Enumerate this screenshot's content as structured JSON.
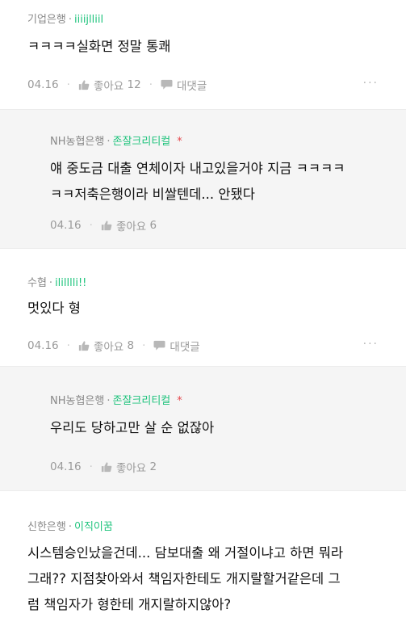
{
  "comments": [
    {
      "bank": "기업은행",
      "nickname": "iiiijlliil",
      "text_lines": [
        "ㅋㅋㅋㅋ실화면 정말 통쾌"
      ],
      "date": "04.16",
      "like_label": "좋아요",
      "like_count": "12",
      "reply_label": "대댓글",
      "more": "···"
    },
    {
      "bank": "NH농협은행",
      "nickname": "존잘크리티컬",
      "star": "*",
      "text_lines": [
        "얘 중도금 대출 연체이자 내고있을거야 지금 ㅋㅋㅋㅋ",
        "ㅋㅋ저축은행이라 비쌀텐데... 안됐다"
      ],
      "date": "04.16",
      "like_label": "좋아요",
      "like_count": "6"
    },
    {
      "bank": "수협",
      "nickname": "ililllli!!",
      "text_lines": [
        "멋있다 형"
      ],
      "date": "04.16",
      "like_label": "좋아요",
      "like_count": "8",
      "reply_label": "대댓글",
      "more": "···"
    },
    {
      "bank": "NH농협은행",
      "nickname": "존잘크리티컬",
      "star": "*",
      "text_lines": [
        "우리도 당하고만 살 순 없잖아"
      ],
      "date": "04.16",
      "like_label": "좋아요",
      "like_count": "2"
    },
    {
      "bank": "신한은행",
      "nickname": "이직이꿈",
      "text_lines": [
        "시스템승인났을건데... 담보대출 왜 거절이냐고 하면 뭐라",
        "그래?? 지점찾아와서 책임자한테도 개지랄할거같은데 그",
        "럼 책임자가 형한테 개지랄하지않아?"
      ]
    }
  ],
  "colors": {
    "nickname": "#1ec37c",
    "star": "#e5484d",
    "reply_bg": "#f5f5f5"
  },
  "icons": {
    "like": "thumbs-up-icon",
    "reply": "speech-bubble-icon",
    "more": "more-dots-icon"
  }
}
